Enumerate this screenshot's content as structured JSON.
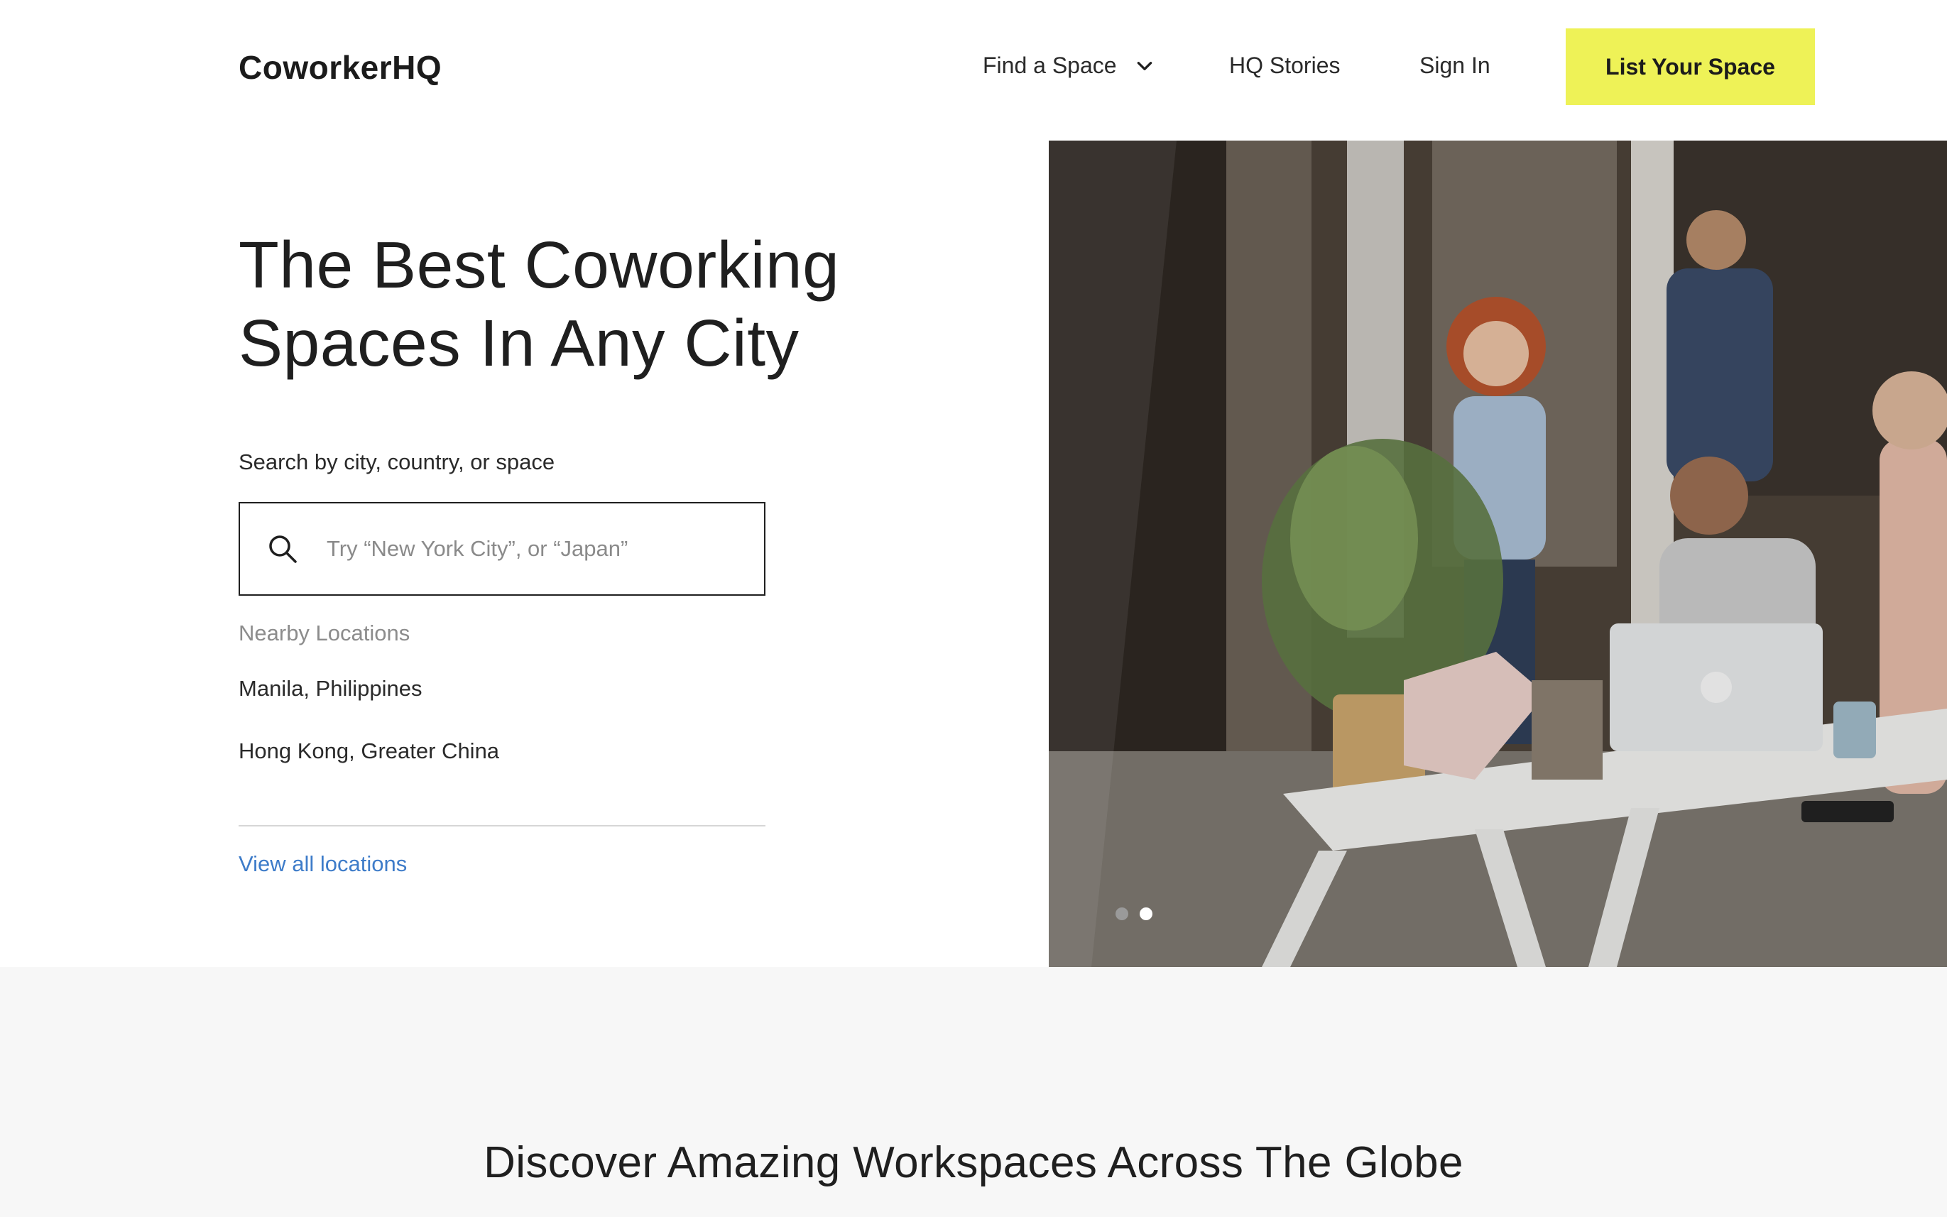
{
  "brand": {
    "logo": "CoworkerHQ",
    "accent": "#eef257",
    "link_color": "#3e7cc9"
  },
  "nav": {
    "find_space": "Find a Space",
    "hq_stories": "HQ Stories",
    "sign_in": "Sign In",
    "cta": "List Your Space"
  },
  "hero": {
    "title_line1": "The Best Coworking",
    "title_line2": "Spaces In Any City",
    "search_label": "Search by city, country, or space",
    "search_placeholder": "Try “New York City”, or “Japan”",
    "search_value": "",
    "nearby_label": "Nearby Locations",
    "nearby": [
      {
        "label": "Manila, Philippines"
      },
      {
        "label": "Hong Kong, Greater China"
      }
    ],
    "view_all": "View all locations"
  },
  "carousel": {
    "slides": 2,
    "active_index": 1
  },
  "icons": {
    "search": "search-icon",
    "dropdown": "chevron-down-icon"
  },
  "section": {
    "heading": "Discover Amazing Workspaces Across The Globe"
  }
}
